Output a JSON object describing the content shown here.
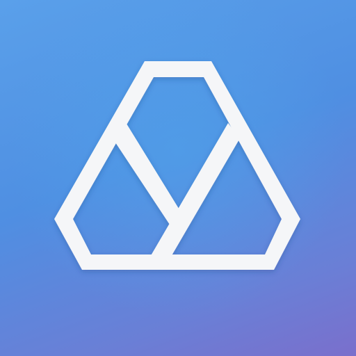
{
  "app": {
    "icon_name": "hexagon-triangle-logo-icon",
    "colors": {
      "background_top": "#5aa0ea",
      "background_mid": "#4f8fe2",
      "background_bottom": "#7a6fcc",
      "glyph": "#f5f6f8",
      "glyph_shadow": "#1e3a78"
    }
  }
}
